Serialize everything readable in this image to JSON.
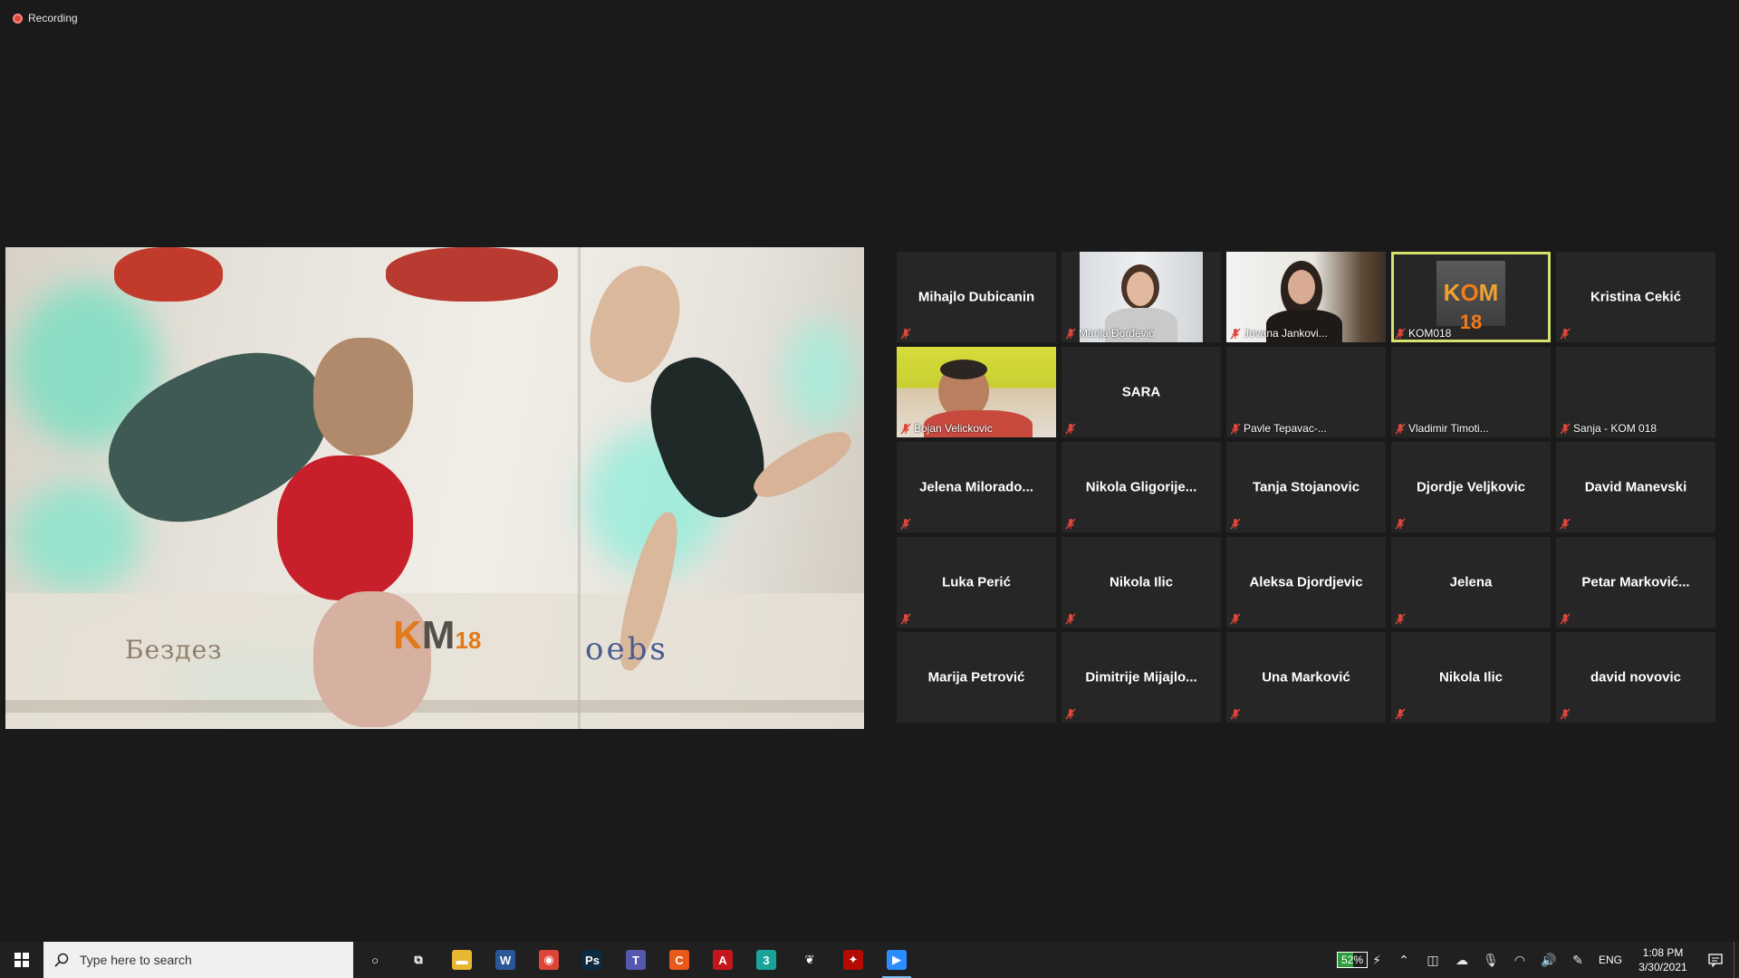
{
  "recording": {
    "label": "Recording"
  },
  "main_video": {
    "logos": {
      "left": "Бездез",
      "mid_a": "K",
      "mid_b": "M",
      "mid_c": "18",
      "right": "oebs",
      "right_sub": ""
    }
  },
  "gallery": {
    "tiles": [
      {
        "name": "Mihajlo Dubicanin",
        "mode": "name",
        "muted": true
      },
      {
        "name": "Marija Đorđević",
        "mode": "video",
        "video": "marija",
        "muted": true
      },
      {
        "name": "Jovana Jankovi...",
        "mode": "video",
        "video": "jovana",
        "muted": true
      },
      {
        "name": "KOM018",
        "mode": "video",
        "video": "kom",
        "muted": true,
        "active": true
      },
      {
        "name": "Kristina Cekić",
        "mode": "name",
        "muted": true
      },
      {
        "name": "Bojan Velickovic",
        "mode": "video",
        "video": "bojan",
        "muted": true
      },
      {
        "name": "SARA",
        "mode": "name",
        "muted": true
      },
      {
        "name": "Pavle Tepavac-...",
        "mode": "label",
        "muted": true
      },
      {
        "name": "Vladimir Timoti...",
        "mode": "label",
        "muted": true
      },
      {
        "name": "Sanja - KOM 018",
        "mode": "label",
        "muted": true
      },
      {
        "name": "Jelena  Milorado...",
        "mode": "name",
        "muted": true
      },
      {
        "name": "Nikola  Gligorije...",
        "mode": "name",
        "muted": true
      },
      {
        "name": "Tanja Stojanovic",
        "mode": "name",
        "muted": true
      },
      {
        "name": "Djordje Veljkovic",
        "mode": "name",
        "muted": true
      },
      {
        "name": "David Manevski",
        "mode": "name",
        "muted": true
      },
      {
        "name": "Luka Perić",
        "mode": "name",
        "muted": true
      },
      {
        "name": "Nikola Ilic",
        "mode": "name",
        "muted": true
      },
      {
        "name": "Aleksa Djordjevic",
        "mode": "name",
        "muted": true
      },
      {
        "name": "Jelena",
        "mode": "name",
        "muted": true
      },
      {
        "name": "Petar  Marković...",
        "mode": "name",
        "muted": true
      },
      {
        "name": "Marija Petrović",
        "mode": "name",
        "muted": false
      },
      {
        "name": "Dimitrije  Mijajlo...",
        "mode": "name",
        "muted": true
      },
      {
        "name": "Una Marković",
        "mode": "name",
        "muted": true
      },
      {
        "name": "Nikola Ilic",
        "mode": "name",
        "muted": true
      },
      {
        "name": "david novovic",
        "mode": "name",
        "muted": true
      }
    ]
  },
  "taskbar": {
    "search_placeholder": "Type here to search",
    "apps": [
      {
        "name": "cortana-icon",
        "glyph": "○",
        "bg": "transparent"
      },
      {
        "name": "task-view-icon",
        "glyph": "⧉",
        "bg": "transparent"
      },
      {
        "name": "file-explorer-icon",
        "glyph": "▬",
        "bg": "#e8b731"
      },
      {
        "name": "word-icon",
        "glyph": "W",
        "bg": "#2b5797"
      },
      {
        "name": "chrome-icon",
        "glyph": "◉",
        "bg": "#db4437"
      },
      {
        "name": "photoshop-icon",
        "glyph": "Ps",
        "bg": "#0b2a3f"
      },
      {
        "name": "teams-icon",
        "glyph": "T",
        "bg": "#5558af"
      },
      {
        "name": "recorder-icon",
        "glyph": "C",
        "bg": "#e8591a"
      },
      {
        "name": "autocad-icon",
        "glyph": "A",
        "bg": "#c4161c"
      },
      {
        "name": "three-icon",
        "glyph": "3",
        "bg": "#1aa39a"
      },
      {
        "name": "feather-icon",
        "glyph": "❦",
        "bg": "transparent"
      },
      {
        "name": "acrobat-icon",
        "glyph": "✦",
        "bg": "#b30b00"
      },
      {
        "name": "zoom-icon",
        "glyph": "▶",
        "bg": "#2d8cff",
        "active": true
      }
    ],
    "battery": {
      "percent_label": "52%",
      "level": 0.52
    },
    "language": "ENG",
    "time": "1:08 PM",
    "date": "3/30/2021"
  }
}
